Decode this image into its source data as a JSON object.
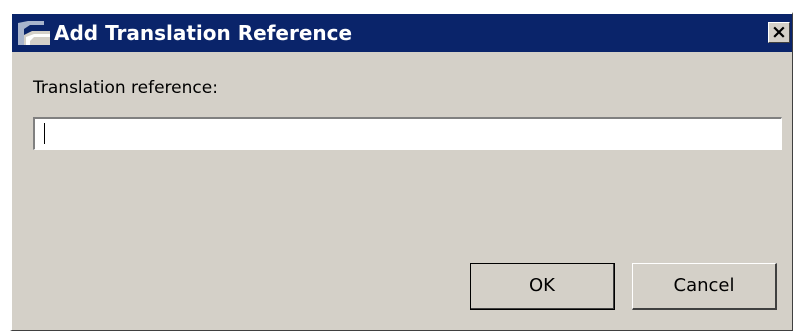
{
  "dialog": {
    "title": "Add Translation Reference",
    "title_icon": "app-icon",
    "close_glyph": "×",
    "colors": {
      "titlebar": "#0a246a",
      "title_text": "#ffffff",
      "background": "#d4d0c8"
    }
  },
  "form": {
    "label": "Translation reference:",
    "value": "",
    "placeholder": ""
  },
  "buttons": {
    "ok": "OK",
    "cancel": "Cancel"
  }
}
